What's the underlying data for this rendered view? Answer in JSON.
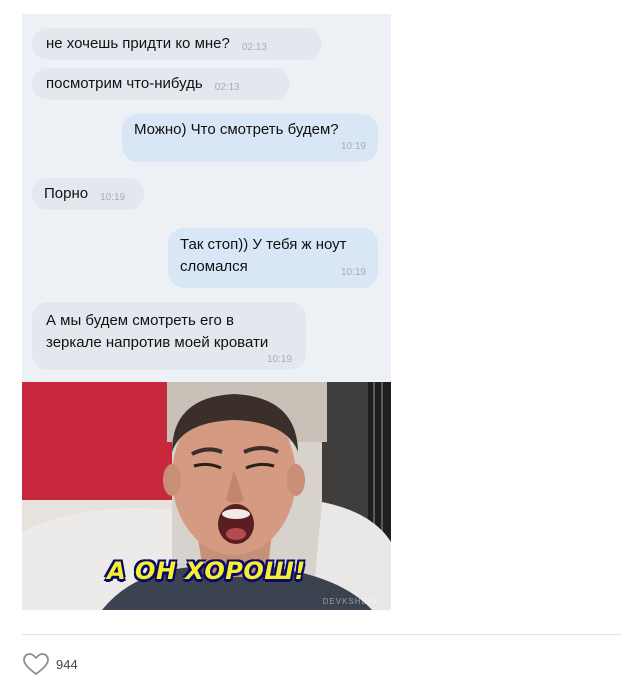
{
  "messages": [
    {
      "side": "in",
      "text": "не хочешь придти ко мне?",
      "time": "02:13"
    },
    {
      "side": "in",
      "text": "посмотрим что-нибудь",
      "time": "02:13"
    },
    {
      "side": "out",
      "text": "Можно) Что смотреть будем?",
      "time": "10:19"
    },
    {
      "side": "in",
      "text": "Порно",
      "time": "10:19"
    },
    {
      "side": "out",
      "line1": "Так стоп)) У тебя ж ноут",
      "line2": "сломался",
      "time": "10:19"
    },
    {
      "side": "in",
      "line1": "А мы будем смотреть его в",
      "line2": "зеркале напротив моей кровати",
      "time": "10:19"
    }
  ],
  "meme": {
    "caption": "А ОН ХОРОШ!",
    "watermark": "DEVKSHEAR"
  },
  "post": {
    "like_icon": "heart-icon",
    "likes": "944"
  },
  "colors": {
    "chat_bg": "#edf0f5",
    "incoming_bubble": "#e4e8ee",
    "outgoing_bubble": "#d8e6f6",
    "timestamp": "#a7adb6",
    "caption_text": "#f6ef2d",
    "caption_outline": "#0a0a6a"
  }
}
